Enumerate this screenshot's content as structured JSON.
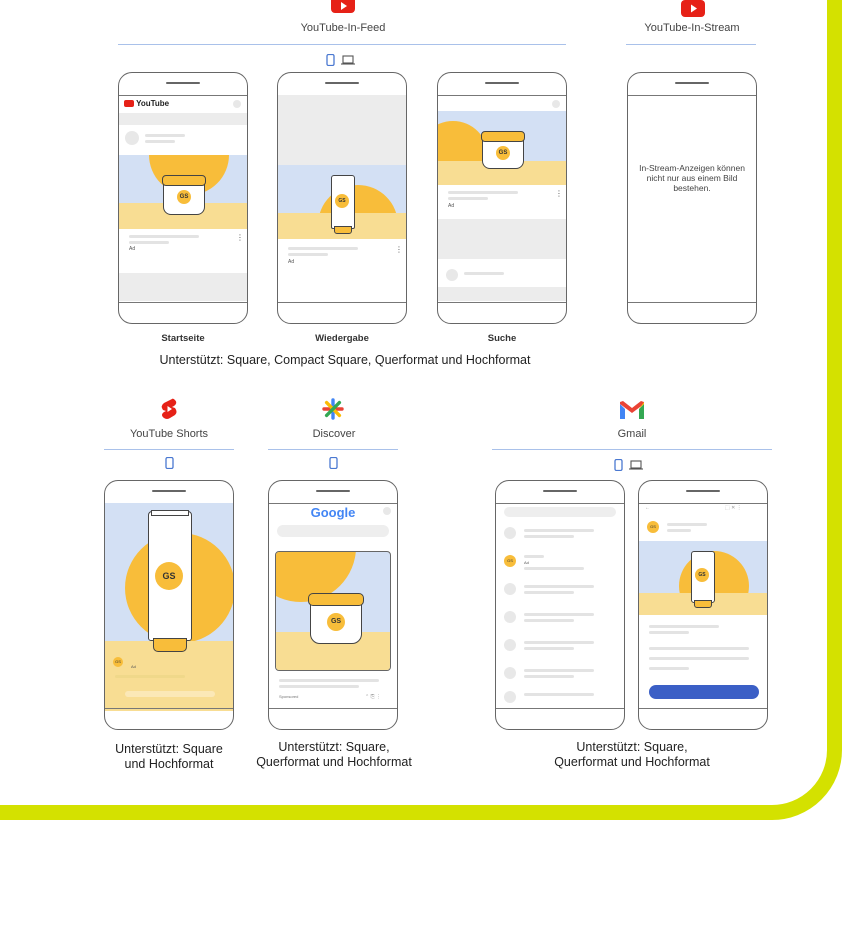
{
  "sections": {
    "in_feed": {
      "title": "YouTube-In-Feed",
      "icon": "youtube-icon"
    },
    "in_stream": {
      "title": "YouTube-In-Stream",
      "icon": "youtube-icon",
      "message": "In-Stream-Anzeigen können nicht nur aus einem Bild bestehen."
    },
    "shorts": {
      "title": "YouTube Shorts",
      "icon": "youtube-shorts-icon"
    },
    "discover": {
      "title": "Discover",
      "icon": "discover-icon"
    },
    "gmail": {
      "title": "Gmail",
      "icon": "gmail-icon"
    }
  },
  "in_feed_phones": [
    "Startseite",
    "Wiedergabe",
    "Suche"
  ],
  "captions": {
    "in_feed": "Unterstützt: Square, Compact Square, Querformat und Hochformat",
    "shorts_1": "Unterstützt: Square",
    "shorts_2": "und Hochformat",
    "discover_1": "Unterstützt: Square,",
    "discover_2": "Querformat und Hochformat",
    "gmail_1": "Unterstützt: Square,",
    "gmail_2": "Querformat und Hochformat"
  },
  "mock_text": {
    "youtube_logo": "YouTube",
    "google_logo": "Google",
    "ad_badge": "Ad",
    "sponsored": "Sponsored",
    "product_monogram": "GS"
  },
  "colors": {
    "frame": "#d4e100",
    "sky": "#d3e0f4",
    "sun": "#f8bd3a",
    "sand": "#f8dd93",
    "accent_blue": "#4a78d1",
    "youtube_red": "#e62117"
  }
}
